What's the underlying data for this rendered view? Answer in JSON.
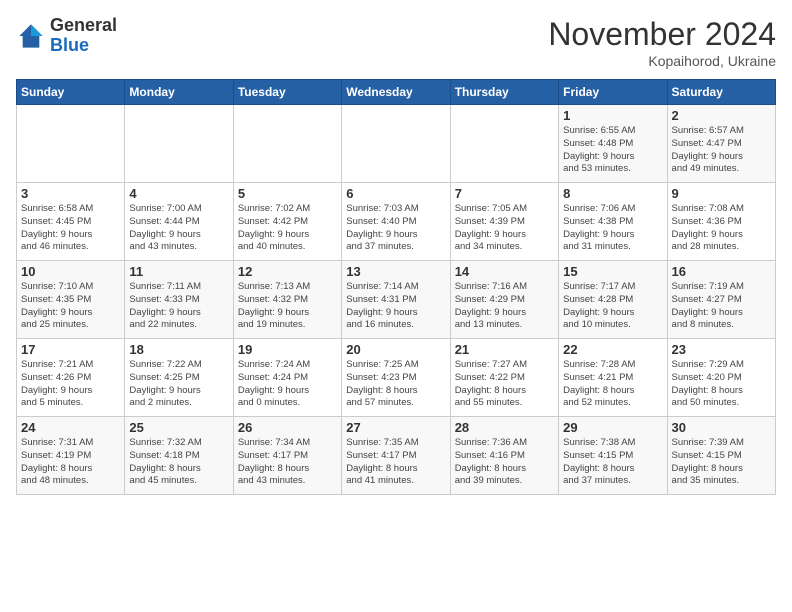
{
  "header": {
    "logo_general": "General",
    "logo_blue": "Blue",
    "month_title": "November 2024",
    "subtitle": "Kopaihorod, Ukraine"
  },
  "columns": [
    "Sunday",
    "Monday",
    "Tuesday",
    "Wednesday",
    "Thursday",
    "Friday",
    "Saturday"
  ],
  "rows": [
    [
      {
        "day": "",
        "detail": ""
      },
      {
        "day": "",
        "detail": ""
      },
      {
        "day": "",
        "detail": ""
      },
      {
        "day": "",
        "detail": ""
      },
      {
        "day": "",
        "detail": ""
      },
      {
        "day": "1",
        "detail": "Sunrise: 6:55 AM\nSunset: 4:48 PM\nDaylight: 9 hours\nand 53 minutes."
      },
      {
        "day": "2",
        "detail": "Sunrise: 6:57 AM\nSunset: 4:47 PM\nDaylight: 9 hours\nand 49 minutes."
      }
    ],
    [
      {
        "day": "3",
        "detail": "Sunrise: 6:58 AM\nSunset: 4:45 PM\nDaylight: 9 hours\nand 46 minutes."
      },
      {
        "day": "4",
        "detail": "Sunrise: 7:00 AM\nSunset: 4:44 PM\nDaylight: 9 hours\nand 43 minutes."
      },
      {
        "day": "5",
        "detail": "Sunrise: 7:02 AM\nSunset: 4:42 PM\nDaylight: 9 hours\nand 40 minutes."
      },
      {
        "day": "6",
        "detail": "Sunrise: 7:03 AM\nSunset: 4:40 PM\nDaylight: 9 hours\nand 37 minutes."
      },
      {
        "day": "7",
        "detail": "Sunrise: 7:05 AM\nSunset: 4:39 PM\nDaylight: 9 hours\nand 34 minutes."
      },
      {
        "day": "8",
        "detail": "Sunrise: 7:06 AM\nSunset: 4:38 PM\nDaylight: 9 hours\nand 31 minutes."
      },
      {
        "day": "9",
        "detail": "Sunrise: 7:08 AM\nSunset: 4:36 PM\nDaylight: 9 hours\nand 28 minutes."
      }
    ],
    [
      {
        "day": "10",
        "detail": "Sunrise: 7:10 AM\nSunset: 4:35 PM\nDaylight: 9 hours\nand 25 minutes."
      },
      {
        "day": "11",
        "detail": "Sunrise: 7:11 AM\nSunset: 4:33 PM\nDaylight: 9 hours\nand 22 minutes."
      },
      {
        "day": "12",
        "detail": "Sunrise: 7:13 AM\nSunset: 4:32 PM\nDaylight: 9 hours\nand 19 minutes."
      },
      {
        "day": "13",
        "detail": "Sunrise: 7:14 AM\nSunset: 4:31 PM\nDaylight: 9 hours\nand 16 minutes."
      },
      {
        "day": "14",
        "detail": "Sunrise: 7:16 AM\nSunset: 4:29 PM\nDaylight: 9 hours\nand 13 minutes."
      },
      {
        "day": "15",
        "detail": "Sunrise: 7:17 AM\nSunset: 4:28 PM\nDaylight: 9 hours\nand 10 minutes."
      },
      {
        "day": "16",
        "detail": "Sunrise: 7:19 AM\nSunset: 4:27 PM\nDaylight: 9 hours\nand 8 minutes."
      }
    ],
    [
      {
        "day": "17",
        "detail": "Sunrise: 7:21 AM\nSunset: 4:26 PM\nDaylight: 9 hours\nand 5 minutes."
      },
      {
        "day": "18",
        "detail": "Sunrise: 7:22 AM\nSunset: 4:25 PM\nDaylight: 9 hours\nand 2 minutes."
      },
      {
        "day": "19",
        "detail": "Sunrise: 7:24 AM\nSunset: 4:24 PM\nDaylight: 9 hours\nand 0 minutes."
      },
      {
        "day": "20",
        "detail": "Sunrise: 7:25 AM\nSunset: 4:23 PM\nDaylight: 8 hours\nand 57 minutes."
      },
      {
        "day": "21",
        "detail": "Sunrise: 7:27 AM\nSunset: 4:22 PM\nDaylight: 8 hours\nand 55 minutes."
      },
      {
        "day": "22",
        "detail": "Sunrise: 7:28 AM\nSunset: 4:21 PM\nDaylight: 8 hours\nand 52 minutes."
      },
      {
        "day": "23",
        "detail": "Sunrise: 7:29 AM\nSunset: 4:20 PM\nDaylight: 8 hours\nand 50 minutes."
      }
    ],
    [
      {
        "day": "24",
        "detail": "Sunrise: 7:31 AM\nSunset: 4:19 PM\nDaylight: 8 hours\nand 48 minutes."
      },
      {
        "day": "25",
        "detail": "Sunrise: 7:32 AM\nSunset: 4:18 PM\nDaylight: 8 hours\nand 45 minutes."
      },
      {
        "day": "26",
        "detail": "Sunrise: 7:34 AM\nSunset: 4:17 PM\nDaylight: 8 hours\nand 43 minutes."
      },
      {
        "day": "27",
        "detail": "Sunrise: 7:35 AM\nSunset: 4:17 PM\nDaylight: 8 hours\nand 41 minutes."
      },
      {
        "day": "28",
        "detail": "Sunrise: 7:36 AM\nSunset: 4:16 PM\nDaylight: 8 hours\nand 39 minutes."
      },
      {
        "day": "29",
        "detail": "Sunrise: 7:38 AM\nSunset: 4:15 PM\nDaylight: 8 hours\nand 37 minutes."
      },
      {
        "day": "30",
        "detail": "Sunrise: 7:39 AM\nSunset: 4:15 PM\nDaylight: 8 hours\nand 35 minutes."
      }
    ]
  ]
}
